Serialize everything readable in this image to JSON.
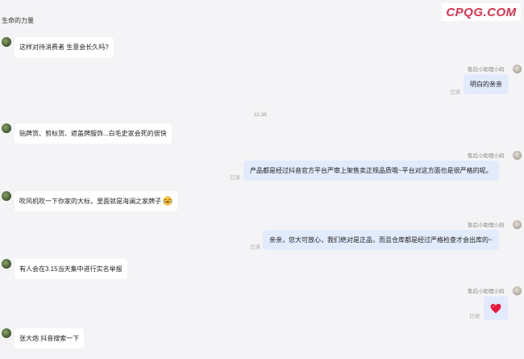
{
  "brand_colors": {
    "accent": "#e0304c",
    "agent_bubble": "#e2ebfb",
    "user_bubble": "#ffffff",
    "background": "#f4f4f6"
  },
  "chat": {
    "title": "生命的力量",
    "watermark": "CPQG.COM",
    "timestamp": "11:38",
    "agent_name": "售后小助理小码",
    "read_label": "已读",
    "messages": [
      {
        "side": "left",
        "text": "这样对待消费者 生意会长久吗?"
      },
      {
        "side": "right",
        "text": "明白的亲亲"
      },
      {
        "side": "left",
        "text": "贴牌货、剪标货、遮盖牌服饰...白毛史家会死的很快"
      },
      {
        "side": "right",
        "text": "产品都是经过抖音官方平台严审上架售卖正规品质哦~平台对这方面也是很严格的呢。"
      },
      {
        "side": "left",
        "text": "吹风机吹一下你家的大标，里面就是海澜之家牌子",
        "emoji": "rofl-icon"
      },
      {
        "side": "right",
        "text": "亲亲，您大可放心，我们绝对是正品，而且仓库都是经过严格检查才会出库的~"
      },
      {
        "side": "left",
        "text": "有人会在3.15当天集中进行实名举报"
      },
      {
        "side": "right",
        "emoji": "red-heart-icon"
      },
      {
        "side": "left",
        "text": "张大炮 抖音搜索一下"
      }
    ]
  }
}
